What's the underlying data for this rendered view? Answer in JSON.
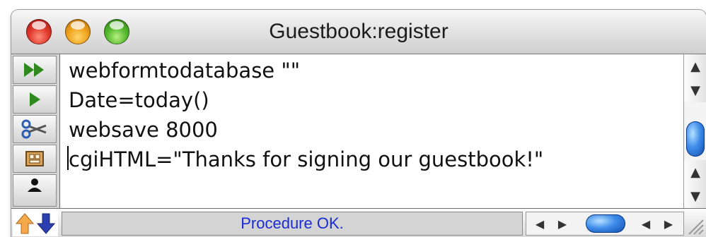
{
  "window": {
    "title": "Guestbook:register"
  },
  "toolbar": {
    "tools": [
      {
        "icon": "run-all-icon"
      },
      {
        "icon": "run-icon"
      },
      {
        "icon": "scissors-icon"
      },
      {
        "icon": "clipboard-icon"
      },
      {
        "icon": "user-icon"
      }
    ]
  },
  "editor": {
    "lines": [
      "webformtodatabase \"\"",
      "Date=today()",
      "websave 8000",
      "cgiHTML=\"Thanks for signing our guestbook!\""
    ]
  },
  "status": {
    "text": "Procedure OK."
  },
  "colors": {
    "status_text": "#1a2bd6",
    "scroll_thumb": "#3d8bea"
  }
}
